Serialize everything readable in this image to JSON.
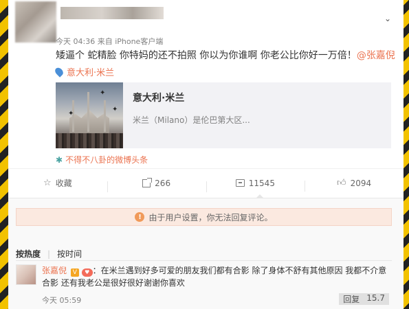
{
  "post": {
    "meta": "今天 04:36 来自 iPhone客户端",
    "text": "矮逼个 蛇精脸 你特妈的还不拍照 你以为你谁啊 你老公比你好一万倍！",
    "mention": "@张嘉倪",
    "location": "意大利·米兰",
    "link_card": {
      "title": "意大利·米兰",
      "description": "米兰（Milano）是伦巴第大区..."
    },
    "source": "不得不八卦的微博头条"
  },
  "actions": {
    "favorite": "收藏",
    "repost": "266",
    "comment": "11545",
    "like": "2094"
  },
  "comments": {
    "notice": "由于用户设置，你无法回复评论。",
    "sort_hot": "按热度",
    "sort_time": "按时间",
    "items": [
      {
        "user": "张嘉倪",
        "text": "：在米兰遇到好多可爱的朋友我们都有合影 除了身体不舒有其他原因 我都不介意合影 还有我老公是很好很好谢谢你喜欢",
        "time": "今天 05:59",
        "reply": "回复",
        "likes": "15.7"
      }
    ]
  },
  "colors": {
    "accent": "#eb7350",
    "notice_bg": "#fbe9e0"
  }
}
